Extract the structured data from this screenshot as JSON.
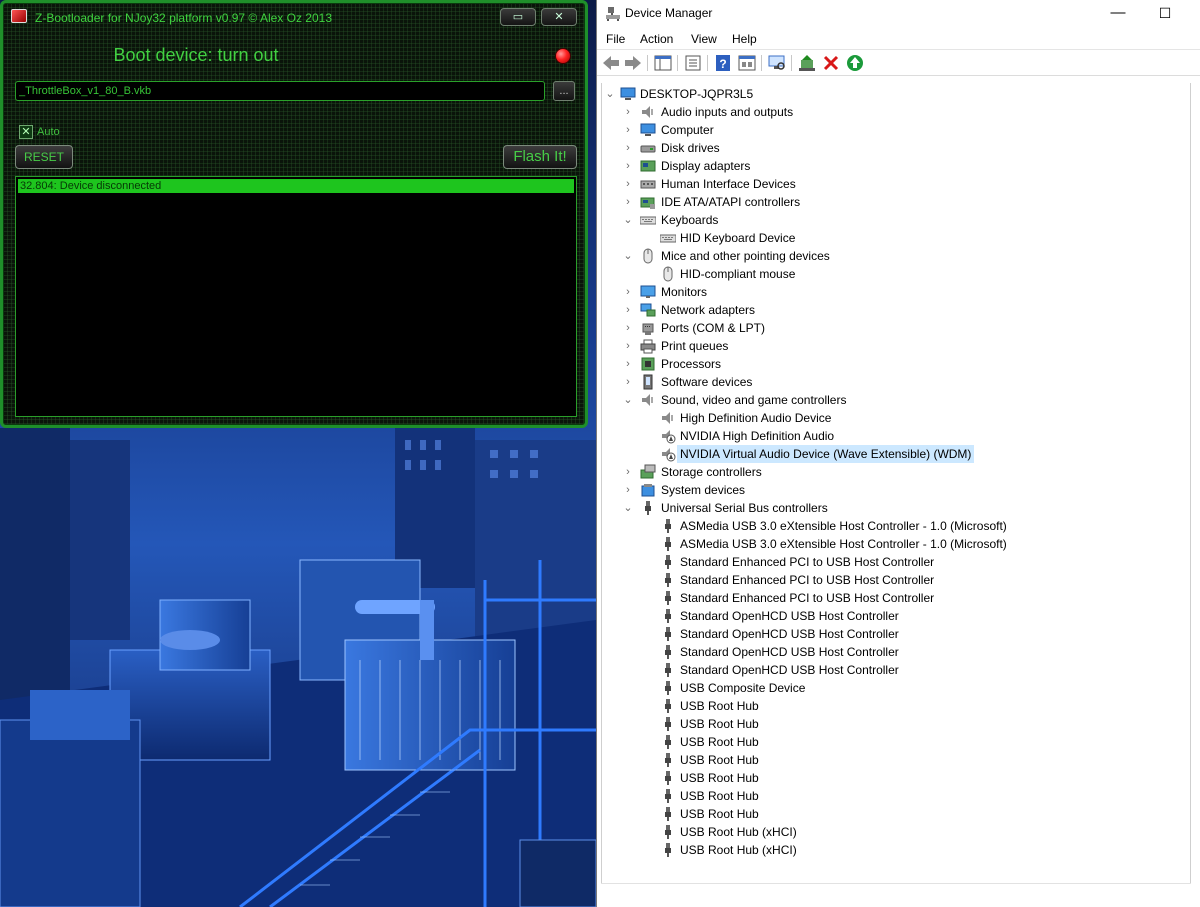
{
  "zbootloader": {
    "title": "Z-Bootloader for NJoy32 platform v0.97 © Alex Oz 2013",
    "status": "Boot device: turn out",
    "file_path": "_ThrottleBox_v1_80_B.vkb",
    "browse_label": "...",
    "auto_label": "Auto",
    "auto_checked": true,
    "reset_label": "RESET",
    "flash_label": "Flash It!",
    "log": [
      "32.804: Device disconnected"
    ],
    "led_color": "#ff2222",
    "accent_color": "#3fd33f"
  },
  "device_manager": {
    "title": "Device Manager",
    "menu": [
      "File",
      "Action",
      "View",
      "Help"
    ],
    "toolbar": [
      "back-icon",
      "forward-icon",
      "show-hide-console-tree-icon",
      "properties-icon",
      "help-icon",
      "view-icon",
      "scan-hardware-icon",
      "update-driver-icon",
      "uninstall-icon",
      "enable-device-icon"
    ],
    "root": "DESKTOP-JQPR3L5",
    "tree": [
      {
        "label": "Audio inputs and outputs",
        "icon": "speaker-icon",
        "expanded": false,
        "children": []
      },
      {
        "label": "Computer",
        "icon": "computer-icon",
        "expanded": false,
        "children": []
      },
      {
        "label": "Disk drives",
        "icon": "disk-icon",
        "expanded": false,
        "children": []
      },
      {
        "label": "Display adapters",
        "icon": "display-adapter-icon",
        "expanded": false,
        "children": []
      },
      {
        "label": "Human Interface Devices",
        "icon": "hid-icon",
        "expanded": false,
        "children": []
      },
      {
        "label": "IDE ATA/ATAPI controllers",
        "icon": "ide-icon",
        "expanded": false,
        "children": []
      },
      {
        "label": "Keyboards",
        "icon": "keyboard-icon",
        "expanded": true,
        "children": [
          {
            "label": "HID Keyboard Device",
            "icon": "keyboard-icon"
          }
        ]
      },
      {
        "label": "Mice and other pointing devices",
        "icon": "mouse-icon",
        "expanded": true,
        "children": [
          {
            "label": "HID-compliant mouse",
            "icon": "mouse-icon"
          }
        ]
      },
      {
        "label": "Monitors",
        "icon": "monitor-icon",
        "expanded": false,
        "children": []
      },
      {
        "label": "Network adapters",
        "icon": "network-icon",
        "expanded": false,
        "children": []
      },
      {
        "label": "Ports (COM & LPT)",
        "icon": "port-icon",
        "expanded": false,
        "children": []
      },
      {
        "label": "Print queues",
        "icon": "printer-icon",
        "expanded": false,
        "children": []
      },
      {
        "label": "Processors",
        "icon": "processor-icon",
        "expanded": false,
        "children": []
      },
      {
        "label": "Software devices",
        "icon": "software-device-icon",
        "expanded": false,
        "children": []
      },
      {
        "label": "Sound, video and game controllers",
        "icon": "speaker-icon",
        "expanded": true,
        "children": [
          {
            "label": "High Definition Audio Device",
            "icon": "speaker-icon"
          },
          {
            "label": "NVIDIA High Definition Audio",
            "icon": "speaker-warning-icon"
          },
          {
            "label": "NVIDIA Virtual Audio Device (Wave Extensible) (WDM)",
            "icon": "speaker-warning-icon",
            "selected": true
          }
        ]
      },
      {
        "label": "Storage controllers",
        "icon": "storage-icon",
        "expanded": false,
        "children": []
      },
      {
        "label": "System devices",
        "icon": "system-device-icon",
        "expanded": false,
        "children": []
      },
      {
        "label": "Universal Serial Bus controllers",
        "icon": "usb-icon",
        "expanded": true,
        "children": [
          {
            "label": "ASMedia USB 3.0 eXtensible Host Controller - 1.0 (Microsoft)",
            "icon": "usb-icon"
          },
          {
            "label": "ASMedia USB 3.0 eXtensible Host Controller - 1.0 (Microsoft)",
            "icon": "usb-icon"
          },
          {
            "label": "Standard Enhanced PCI to USB Host Controller",
            "icon": "usb-icon"
          },
          {
            "label": "Standard Enhanced PCI to USB Host Controller",
            "icon": "usb-icon"
          },
          {
            "label": "Standard Enhanced PCI to USB Host Controller",
            "icon": "usb-icon"
          },
          {
            "label": "Standard OpenHCD USB Host Controller",
            "icon": "usb-icon"
          },
          {
            "label": "Standard OpenHCD USB Host Controller",
            "icon": "usb-icon"
          },
          {
            "label": "Standard OpenHCD USB Host Controller",
            "icon": "usb-icon"
          },
          {
            "label": "Standard OpenHCD USB Host Controller",
            "icon": "usb-icon"
          },
          {
            "label": "USB Composite Device",
            "icon": "usb-icon"
          },
          {
            "label": "USB Root Hub",
            "icon": "usb-icon"
          },
          {
            "label": "USB Root Hub",
            "icon": "usb-icon"
          },
          {
            "label": "USB Root Hub",
            "icon": "usb-icon"
          },
          {
            "label": "USB Root Hub",
            "icon": "usb-icon"
          },
          {
            "label": "USB Root Hub",
            "icon": "usb-icon"
          },
          {
            "label": "USB Root Hub",
            "icon": "usb-icon"
          },
          {
            "label": "USB Root Hub",
            "icon": "usb-icon"
          },
          {
            "label": "USB Root Hub (xHCI)",
            "icon": "usb-icon"
          },
          {
            "label": "USB Root Hub (xHCI)",
            "icon": "usb-icon"
          }
        ]
      }
    ],
    "selection_color": "#cce8ff"
  }
}
